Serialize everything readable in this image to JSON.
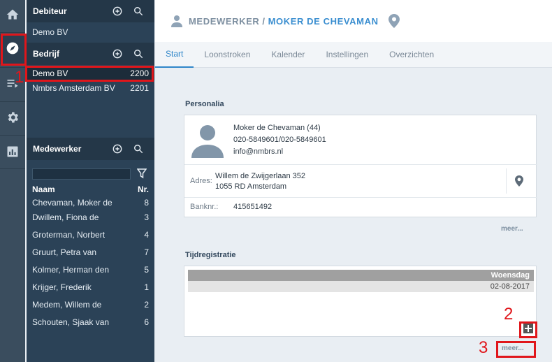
{
  "rail": {
    "items": [
      {
        "name": "home-icon",
        "active": false
      },
      {
        "name": "compass-icon",
        "active": true
      },
      {
        "name": "list-play-icon",
        "active": false
      },
      {
        "name": "gear-icon",
        "active": false
      },
      {
        "name": "bar-chart-icon",
        "active": false
      }
    ]
  },
  "sidebar": {
    "debiteur": {
      "title": "Debiteur",
      "items": [
        {
          "label": "Demo BV"
        }
      ]
    },
    "bedrijf": {
      "title": "Bedrijf",
      "items": [
        {
          "label": "Demo BV",
          "nr": "2200"
        },
        {
          "label": "Nmbrs Amsterdam BV",
          "nr": "2201"
        }
      ]
    },
    "medewerker": {
      "title": "Medewerker",
      "search_value": "",
      "col_name": "Naam",
      "col_nr": "Nr.",
      "items": [
        {
          "label": "Chevaman, Moker de",
          "nr": "8"
        },
        {
          "label": "Dwillem, Fiona de",
          "nr": "3"
        },
        {
          "label": "Groterman, Norbert",
          "nr": "4"
        },
        {
          "label": "Gruurt, Petra van",
          "nr": "7"
        },
        {
          "label": "Kolmer, Herman den",
          "nr": "5"
        },
        {
          "label": "Krijger, Frederik",
          "nr": "1"
        },
        {
          "label": "Medem, Willem de",
          "nr": "2"
        },
        {
          "label": "Schouten, Sjaak van",
          "nr": "6"
        }
      ]
    }
  },
  "header": {
    "section": "MEDEWERKER",
    "separator": "/",
    "employee": "MOKER DE CHEVAMAN"
  },
  "tabs": [
    "Start",
    "Loonstroken",
    "Kalender",
    "Instellingen",
    "Overzichten"
  ],
  "personalia": {
    "title": "Personalia",
    "name_age": "Moker de Chevaman (44)",
    "phone": "020-5849601/020-5849601",
    "email": "info@nmbrs.nl",
    "address_label": "Adres:",
    "address_line1": "Willem de Zwijgerlaan 352",
    "address_line2": "1055 RD Amsterdam",
    "bank_label": "Banknr.:",
    "bank_value": "415651492",
    "more": "meer..."
  },
  "tijdregistratie": {
    "title": "Tijdregistratie",
    "day": "Woensdag",
    "date": "02-08-2017",
    "more": "meer..."
  },
  "annotations": [
    "1",
    "2",
    "3"
  ],
  "colors": {
    "accent": "#3a8ed0",
    "annotation": "#e0161b",
    "sidebar": "#2b4257"
  }
}
